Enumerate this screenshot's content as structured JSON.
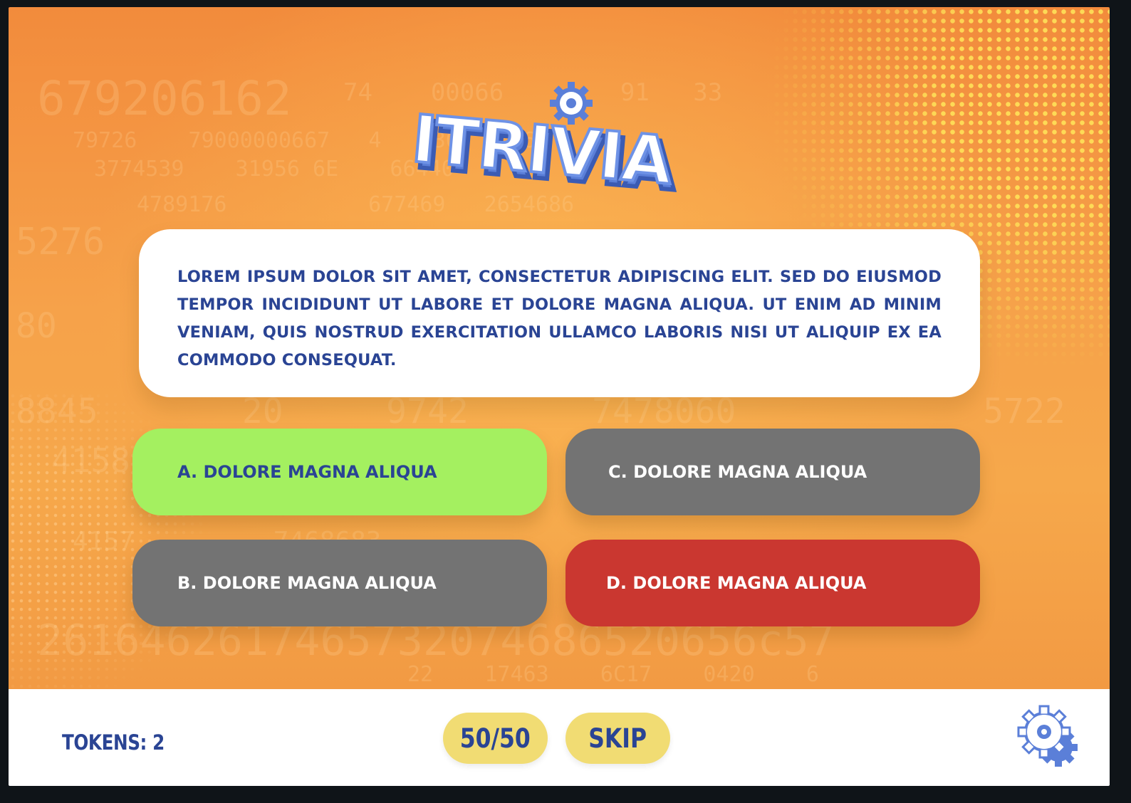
{
  "app": {
    "logo_text": "ITRIVIA",
    "colors": {
      "brand_blue": "#2a4494",
      "correct_green": "#a4f060",
      "neutral_gray": "#737373",
      "wrong_red": "#ca3730",
      "lifeline_yellow": "#f1dc73",
      "background_orange": "#f6a24a"
    }
  },
  "question": {
    "text": "LOREM IPSUM DOLOR SIT AMET, CONSECTETUR ADIPISCING ELIT. SED DO EIUSMOD TEMPOR INCIDIDUNT UT LABORE ET DOLORE MAGNA ALIQUA. UT ENIM AD MINIM VENIAM, QUIS NOSTRUD EXERCITATION ULLAMCO LABORIS NISI UT ALIQUIP EX EA COMMODO CONSEQUAT."
  },
  "answers": [
    {
      "label": "A. DOLORE MAGNA ALIQUA",
      "state": "correct"
    },
    {
      "label": "B. DOLORE MAGNA ALIQUA",
      "state": "neutral"
    },
    {
      "label": "C. DOLORE MAGNA ALIQUA",
      "state": "neutral"
    },
    {
      "label": "D. DOLORE MAGNA ALIQUA",
      "state": "wrong"
    }
  ],
  "footer": {
    "tokens_label": "TOKENS: 2",
    "fifty_fifty_label": "50/50",
    "skip_label": "SKIP",
    "settings_icon": "gear-icon"
  }
}
